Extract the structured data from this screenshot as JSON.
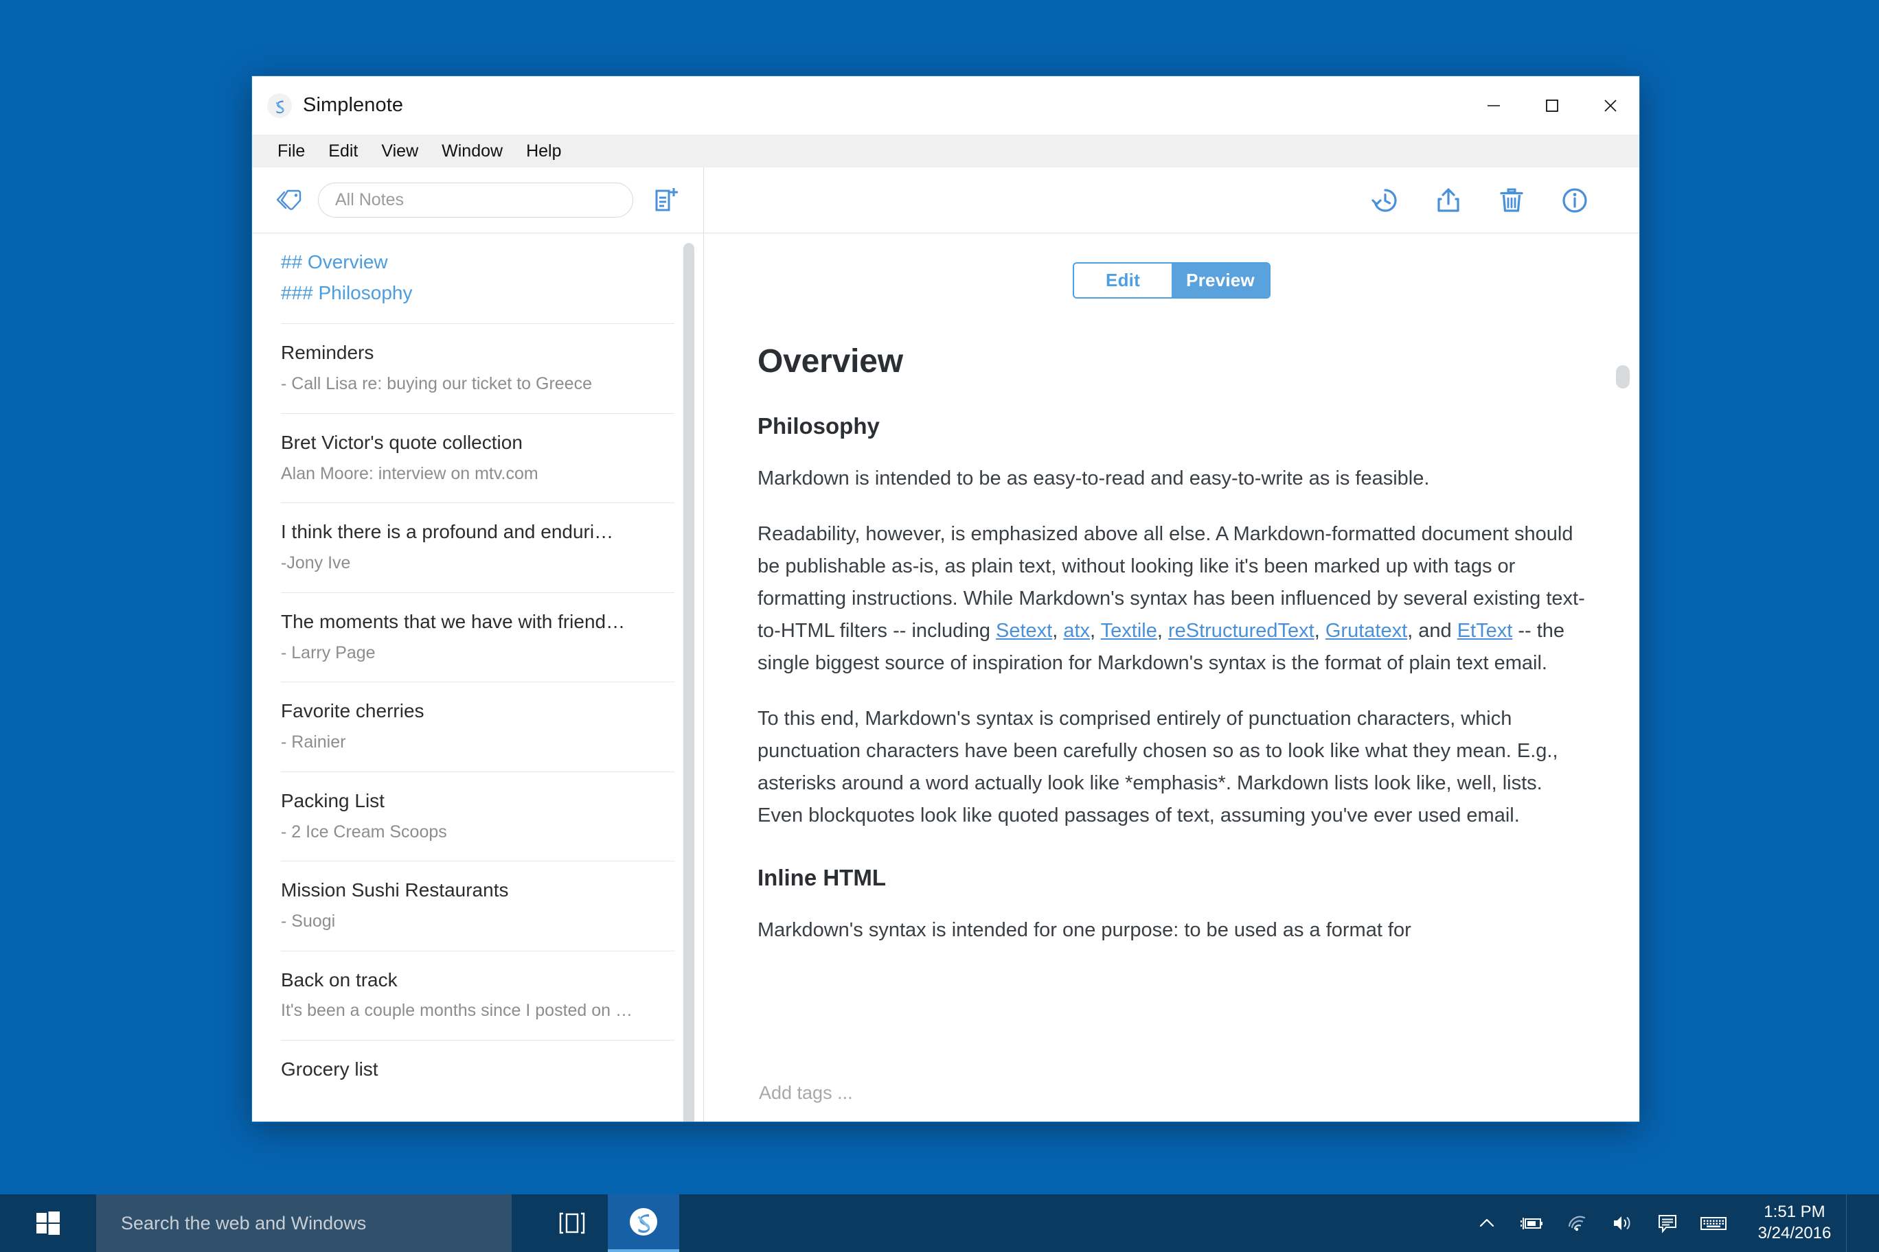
{
  "window": {
    "title": "Simplenote",
    "logo_icon": "simplenote-logo-icon",
    "minimize_icon": "minimize-icon",
    "maximize_icon": "maximize-icon",
    "close_icon": "close-icon"
  },
  "menubar": {
    "items": [
      {
        "label": "File"
      },
      {
        "label": "Edit"
      },
      {
        "label": "View"
      },
      {
        "label": "Window"
      },
      {
        "label": "Help"
      }
    ]
  },
  "left_toolbar": {
    "tag_drawer_icon": "tag-icon",
    "search": {
      "value": "",
      "placeholder": "All Notes"
    },
    "new_note_icon": "new-note-icon"
  },
  "note_list": {
    "notes": [
      {
        "title": "## Overview",
        "preview": "### Philosophy",
        "selected": true
      },
      {
        "title": "Reminders",
        "preview": "- Call Lisa re: buying our ticket to Greece",
        "selected": false
      },
      {
        "title": "Bret Victor's quote collection",
        "preview": "Alan Moore: interview on mtv.com",
        "selected": false
      },
      {
        "title": "I think there is a profound and enduri…",
        "preview": "-Jony Ive",
        "selected": false
      },
      {
        "title": "The moments that we have with friend…",
        "preview": "- Larry Page",
        "selected": false
      },
      {
        "title": "Favorite cherries",
        "preview": "- Rainier",
        "selected": false
      },
      {
        "title": "Packing List",
        "preview": "- 2 Ice Cream Scoops",
        "selected": false
      },
      {
        "title": "Mission Sushi Restaurants",
        "preview": "- Suogi",
        "selected": false
      },
      {
        "title": "Back on track",
        "preview": "It's been a couple months since I posted on …",
        "selected": false
      },
      {
        "title": "Grocery list",
        "preview": "",
        "selected": false
      }
    ]
  },
  "right_toolbar": {
    "icons": [
      {
        "name": "history-icon"
      },
      {
        "name": "share-icon"
      },
      {
        "name": "trash-icon"
      },
      {
        "name": "info-icon"
      }
    ]
  },
  "editor": {
    "mode_toggle": {
      "edit_label": "Edit",
      "preview_label": "Preview",
      "active": "Preview"
    },
    "preview": {
      "heading1": "Overview",
      "heading2_philosophy": "Philosophy",
      "para1": "Markdown is intended to be as easy-to-read and easy-to-write as is feasible.",
      "para2_part1": "Readability, however, is emphasized above all else. A Markdown-formatted document should be publishable as-is, as plain text, without looking like it's been marked up with tags or formatting instructions. While Markdown's syntax has been influenced by several existing text-to-HTML filters -- including ",
      "link_setext": "Setext",
      "sep1": ", ",
      "link_atx": "atx",
      "sep2": ", ",
      "link_textile": "Textile",
      "sep3": ", ",
      "link_restructuredtext": "reStructuredText",
      "sep4": ", ",
      "link_grutatext": "Grutatext",
      "sep5": ", and ",
      "link_ettext": "EtText",
      "para2_part2": " -- the single biggest source of inspiration for Markdown's syntax is the format of plain text email.",
      "para3": "To this end, Markdown's syntax is comprised entirely of punctuation characters, which punctuation characters have been carefully chosen so as to look like what they mean. E.g., asterisks around a word actually look like *emphasis*. Markdown lists look like, well, lists. Even blockquotes look like quoted passages of text, assuming you've ever used email.",
      "heading2_inline_html": "Inline HTML",
      "para4": "Markdown's syntax is intended for one purpose: to be used as a format for"
    },
    "tags": {
      "value": "",
      "placeholder": "Add tags ..."
    }
  },
  "taskbar": {
    "start_icon": "windows-start-icon",
    "search": {
      "value": "",
      "placeholder": "Search the web and Windows"
    },
    "task_view_icon": "task-view-icon",
    "pinned_app": {
      "name": "simplenote-taskbar-icon",
      "label": "Simplenote"
    },
    "tray_icons": [
      {
        "name": "show-hidden-icons-chevron-icon"
      },
      {
        "name": "battery-charging-icon"
      },
      {
        "name": "wifi-icon"
      },
      {
        "name": "volume-icon"
      },
      {
        "name": "action-center-message-icon"
      },
      {
        "name": "touch-keyboard-icon"
      }
    ],
    "clock": {
      "time": "1:51 PM",
      "date": "3/24/2016"
    }
  },
  "colors": {
    "desktop_blue": "#0663b0",
    "accent_blue": "#4a90d9",
    "toggle_active": "#5aa2dd",
    "taskbar": "#0b3a60",
    "taskbar_search": "#31506b"
  }
}
